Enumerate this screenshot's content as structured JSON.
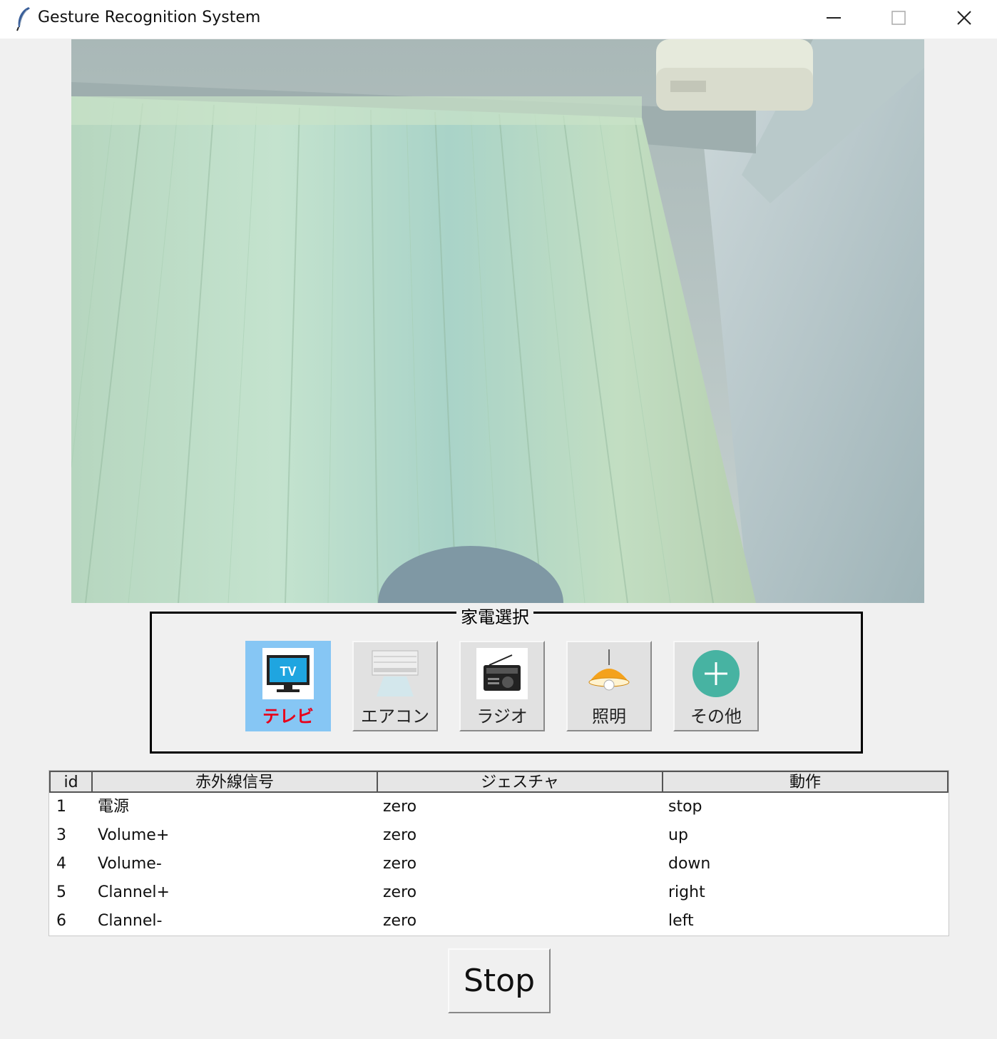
{
  "window": {
    "title": "Gesture Recognition System"
  },
  "group": {
    "legend": "家電選択"
  },
  "devices": [
    {
      "label": "テレビ",
      "icon": "tv-icon",
      "selected": true
    },
    {
      "label": "エアコン",
      "icon": "air-conditioner-icon",
      "selected": false
    },
    {
      "label": "ラジオ",
      "icon": "radio-icon",
      "selected": false
    },
    {
      "label": "照明",
      "icon": "lamp-icon",
      "selected": false
    },
    {
      "label": "その他",
      "icon": "plus-icon",
      "selected": false
    }
  ],
  "table": {
    "columns": [
      "id",
      "赤外線信号",
      "ジェスチャ",
      "動作"
    ],
    "rows": [
      {
        "id": "1",
        "signal": "電源",
        "gesture": "zero",
        "action": "stop"
      },
      {
        "id": "3",
        "signal": "Volume+",
        "gesture": "zero",
        "action": "up"
      },
      {
        "id": "4",
        "signal": "Volume-",
        "gesture": "zero",
        "action": "down"
      },
      {
        "id": "5",
        "signal": "Clannel+",
        "gesture": "zero",
        "action": "right"
      },
      {
        "id": "6",
        "signal": "Clannel-",
        "gesture": "zero",
        "action": "left"
      }
    ]
  },
  "stop_label": "Stop",
  "colors": {
    "selected_bg": "#86c6f4",
    "selected_text": "#e8001a"
  }
}
